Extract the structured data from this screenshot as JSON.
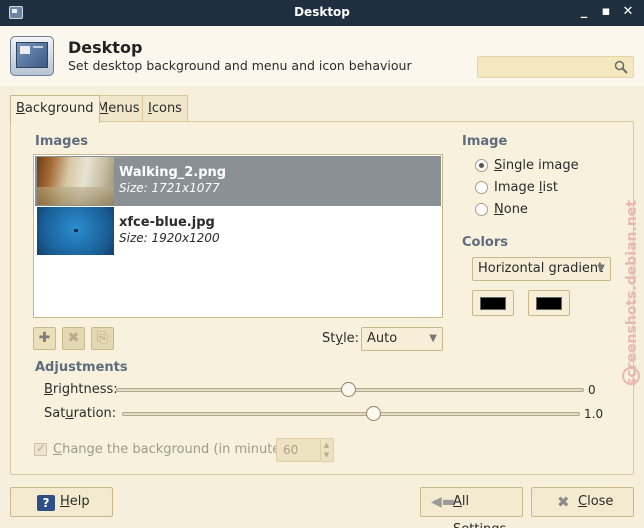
{
  "window": {
    "title": "Desktop"
  },
  "header": {
    "title": "Desktop",
    "subtitle": "Set desktop background and menu and icon behaviour",
    "search_placeholder": ""
  },
  "tabs": [
    {
      "label_pre": "",
      "label_u": "B",
      "label_post": "ackground",
      "active": true
    },
    {
      "label_pre": "",
      "label_u": "M",
      "label_post": "enus",
      "active": false
    },
    {
      "label_pre": "",
      "label_u": "I",
      "label_post": "cons",
      "active": false
    }
  ],
  "images_section": {
    "heading": "Images",
    "items": [
      {
        "name": "Walking_2.png",
        "size": "Size: 1721x1077",
        "selected": true
      },
      {
        "name": "xfce-blue.jpg",
        "size": "Size: 1920x1200",
        "selected": false
      }
    ],
    "style_label_pre": "St",
    "style_label_u": "y",
    "style_label_post": "le:",
    "style_value": "Auto"
  },
  "adjustments": {
    "heading": "Adjustments",
    "brightness": {
      "label_u": "B",
      "label_post": "rightness:",
      "value": "0",
      "level": 0.5
    },
    "saturation": {
      "label_pre": "Sat",
      "label_u": "u",
      "label_post": "ration:",
      "value": "1.0",
      "level": 0.5
    }
  },
  "change_background": {
    "label_u": "C",
    "label_post": "hange the background (in minutes):",
    "checked": true,
    "minutes": "60"
  },
  "image_section": {
    "heading": "Image",
    "options": [
      {
        "label_u": "S",
        "label_post": "ingle image",
        "checked": true
      },
      {
        "label_pre": "Image ",
        "label_u": "l",
        "label_post": "ist",
        "checked": false
      },
      {
        "label_u": "N",
        "label_post": "one",
        "checked": false
      }
    ]
  },
  "colors_section": {
    "heading": "Colors",
    "gradient": "Horizontal gradient",
    "color1": "#000000",
    "color2": "#000000"
  },
  "buttons": {
    "help_u": "H",
    "help_post": "elp",
    "all_settings_u": "A",
    "all_settings_post": "ll Settings",
    "close_u": "C",
    "close_post": "lose"
  },
  "watermark": "screenshots.debian.net"
}
